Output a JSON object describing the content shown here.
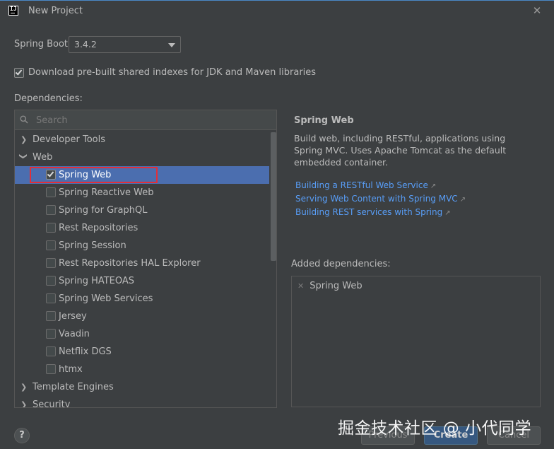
{
  "window": {
    "title": "New Project"
  },
  "spring_boot": {
    "label": "Spring Boot:",
    "selected": "3.4.2"
  },
  "download_indexes": {
    "label": "Download pre-built shared indexes for JDK and Maven libraries",
    "checked": true
  },
  "dependencies": {
    "label": "Dependencies:",
    "search_placeholder": "Search",
    "tree": {
      "developer_tools": "Developer Tools",
      "web": "Web",
      "web_items": [
        {
          "label": "Spring Web",
          "checked": true
        },
        {
          "label": "Spring Reactive Web",
          "checked": false
        },
        {
          "label": "Spring for GraphQL",
          "checked": false
        },
        {
          "label": "Rest Repositories",
          "checked": false
        },
        {
          "label": "Spring Session",
          "checked": false
        },
        {
          "label": "Rest Repositories HAL Explorer",
          "checked": false
        },
        {
          "label": "Spring HATEOAS",
          "checked": false
        },
        {
          "label": "Spring Web Services",
          "checked": false
        },
        {
          "label": "Jersey",
          "checked": false
        },
        {
          "label": "Vaadin",
          "checked": false
        },
        {
          "label": "Netflix DGS",
          "checked": false
        },
        {
          "label": "htmx",
          "checked": false
        }
      ],
      "template_engines": "Template Engines",
      "security": "Security"
    }
  },
  "detail": {
    "title": "Spring Web",
    "description": "Build web, including RESTful, applications using Spring MVC. Uses Apache Tomcat as the default embedded container.",
    "links": [
      "Building a RESTful Web Service",
      "Serving Web Content with Spring MVC",
      "Building REST services with Spring"
    ],
    "link_icon": "external-link-arrow"
  },
  "added_dependencies": {
    "label": "Added dependencies:",
    "items": [
      "Spring Web"
    ]
  },
  "buttons": {
    "help": "?",
    "previous": "Previous",
    "create": "Create",
    "cancel": "Cancel"
  },
  "watermark": "掘金技术社区 @ 小代同学",
  "colors": {
    "background": "#3c3f41",
    "selection": "#4b6eaf",
    "link": "#589df6",
    "highlight_box": "#e0303a",
    "primary_button": "#365880"
  }
}
